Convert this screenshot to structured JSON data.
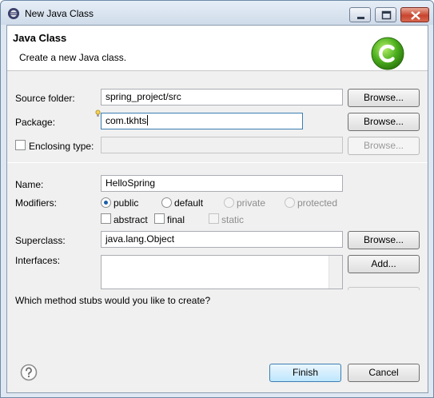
{
  "window": {
    "title": "New Java Class"
  },
  "header": {
    "title": "Java Class",
    "description": "Create a new Java class."
  },
  "form": {
    "source_folder": {
      "label": "Source folder:",
      "value": "spring_project/src",
      "browse": "Browse..."
    },
    "package": {
      "label": "Package:",
      "value": "com.tkhts",
      "browse": "Browse..."
    },
    "enclosing": {
      "label": "Enclosing type:",
      "value": "",
      "browse": "Browse...",
      "checked": false
    },
    "name": {
      "label": "Name:",
      "value": "HelloSpring"
    },
    "modifiers": {
      "label": "Modifiers:",
      "access": [
        "public",
        "default",
        "private",
        "protected"
      ],
      "selected": "public",
      "abstract": "abstract",
      "final": "final",
      "static": "static"
    },
    "superclass": {
      "label": "Superclass:",
      "value": "java.lang.Object",
      "browse": "Browse..."
    },
    "interfaces": {
      "label": "Interfaces:",
      "add": "Add..."
    },
    "stubs_question": "Which method stubs would you like to create?"
  },
  "footer": {
    "finish": "Finish",
    "cancel": "Cancel"
  },
  "colors": {
    "accent": "#3c7fb1",
    "close_button": "#c8452f",
    "class_icon": "#4caf1e"
  }
}
